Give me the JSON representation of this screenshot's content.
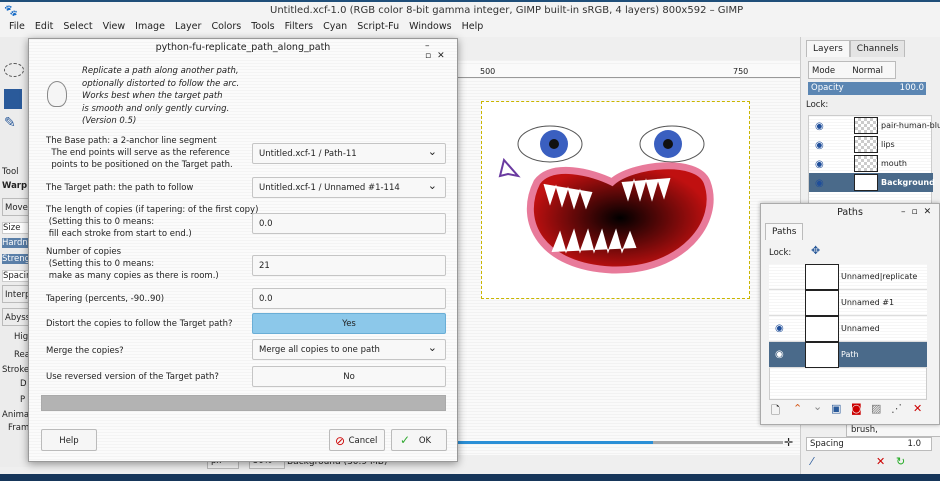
{
  "window": {
    "title": "Untitled.xcf-1.0 (RGB color 8-bit gamma integer, GIMP built-in sRGB, 4 layers) 800x592 – GIMP"
  },
  "menu": [
    "File",
    "Edit",
    "Select",
    "View",
    "Image",
    "Layer",
    "Colors",
    "Tools",
    "Filters",
    "Cyan",
    "Script-Fu",
    "Windows",
    "Help"
  ],
  "tool_options": {
    "tab": "Tool",
    "tool": "Warp T",
    "mode": "Move",
    "size": "Size",
    "hardness": "Hardne",
    "strength": "Strengt",
    "spacing": "Spacing",
    "interp": "Interp",
    "abyss": "Abyss",
    "hq": "Hig",
    "realtime": "Rea",
    "stroke": "Stroke",
    "d": "D",
    "p": "P",
    "animate": "Animate",
    "frames": "Fram"
  },
  "ruler": {
    "ticks": [
      "500",
      "750"
    ]
  },
  "status": {
    "unit": "px",
    "zoom": "50%",
    "layer_info": "Background (30.9 MB)"
  },
  "layers": {
    "tabs": [
      "Layers",
      "Channels"
    ],
    "mode_label": "Mode",
    "mode_value": "Normal",
    "opacity_label": "Opacity",
    "opacity_value": "100.0",
    "lock_label": "Lock:",
    "items": [
      {
        "name": "pair-human-blu"
      },
      {
        "name": "lips"
      },
      {
        "name": "mouth"
      },
      {
        "name": "Background"
      }
    ]
  },
  "brush": {
    "value": "brush,",
    "spacing_label": "Spacing",
    "spacing_value": "1.0"
  },
  "paths": {
    "title": "Paths",
    "tab": "Paths",
    "lock_label": "Lock:",
    "items": [
      {
        "name": "Unnamed|replicate"
      },
      {
        "name": "Unnamed #1"
      },
      {
        "name": "Unnamed"
      },
      {
        "name": "Path"
      }
    ]
  },
  "dialog": {
    "title": "python-fu-replicate_path_along_path",
    "intro": "Replicate a path along another path,\noptionally distorted to follow the arc.\nWorks best when the target path\nis smooth and only gently curving.\n(Version 0.5)",
    "base_label": "The Base path: a 2-anchor line segment\n  The end points will serve as the reference\n  points to be positioned on the Target path.",
    "base_value": "Untitled.xcf-1 / Path-11",
    "target_label": "The Target path: the path to follow",
    "target_value": "Untitled.xcf-1 / Unnamed #1-114",
    "length_label": "The length of copies (if tapering: of the first copy)\n (Setting this to 0 means:\n fill each stroke from start to end.)",
    "length_value": "0.0",
    "number_label": "Number of copies\n (Setting this to 0 means:\n make as many copies as there is room.)",
    "number_value": "21",
    "taper_label": "Tapering (percents, -90..90)",
    "taper_value": "0.0",
    "distort_label": "Distort the copies to follow the Target path?",
    "distort_value": "Yes",
    "merge_label": "Merge the copies?",
    "merge_value": "Merge all copies to one path",
    "reverse_label": "Use reversed version of the Target path?",
    "reverse_value": "No",
    "progress": 0,
    "help": "Help",
    "cancel": "Cancel",
    "ok": "OK"
  }
}
